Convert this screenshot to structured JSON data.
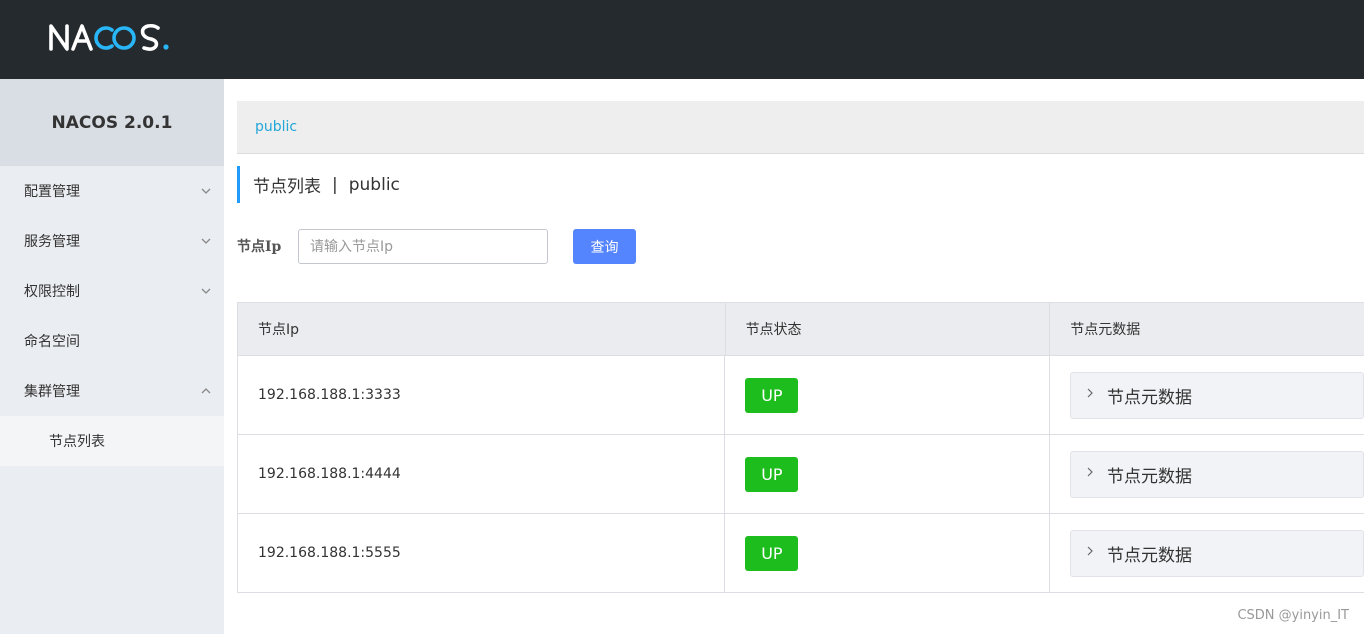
{
  "brand": {
    "logo_text": "NACOS."
  },
  "sidebar": {
    "version": "NACOS 2.0.1",
    "items": [
      {
        "label": "配置管理",
        "chevron": "down"
      },
      {
        "label": "服务管理",
        "chevron": "down"
      },
      {
        "label": "权限控制",
        "chevron": "down"
      },
      {
        "label": "命名空间"
      },
      {
        "label": "集群管理",
        "chevron": "up"
      }
    ],
    "subitems": [
      {
        "label": "节点列表"
      }
    ]
  },
  "breadcrumb": {
    "namespace": "public"
  },
  "page": {
    "title": "节点列表",
    "separator": "|",
    "namespace": "public"
  },
  "search": {
    "label": "节点Ip",
    "placeholder": "请输入节点Ip",
    "value": "",
    "button": "查询"
  },
  "table": {
    "headers": [
      "节点Ip",
      "节点状态",
      "节点元数据"
    ],
    "rows": [
      {
        "ip": "192.168.188.1:3333",
        "status": "UP",
        "meta": "节点元数据"
      },
      {
        "ip": "192.168.188.1:4444",
        "status": "UP",
        "meta": "节点元数据"
      },
      {
        "ip": "192.168.188.1:5555",
        "status": "UP",
        "meta": "节点元数据"
      }
    ]
  },
  "watermark": "CSDN @yinyin_IT",
  "colors": {
    "topbar": "#252a2f",
    "accent": "#209bfa",
    "link": "#23a6d8",
    "button": "#5584ff",
    "status_up": "#1ebd1e",
    "logo_blue": "#29b6f6"
  },
  "icons": [
    "chevron-down-icon",
    "chevron-up-icon",
    "chevron-right-icon"
  ]
}
